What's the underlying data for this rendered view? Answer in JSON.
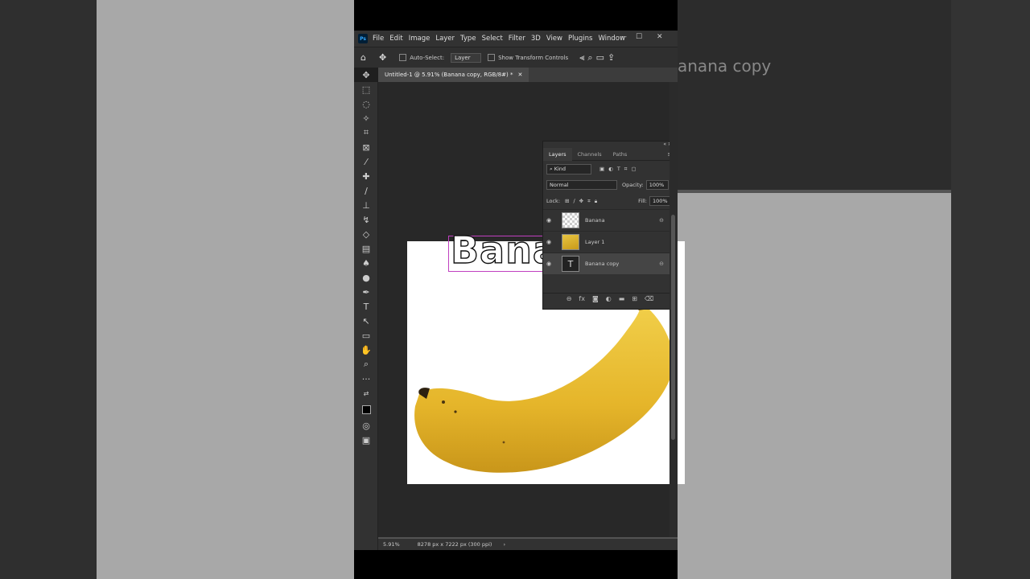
{
  "menubar": {
    "logo": "Ps",
    "items": [
      "File",
      "Edit",
      "Image",
      "Layer",
      "Type",
      "Select",
      "Filter",
      "3D",
      "View",
      "Plugins",
      "Window"
    ]
  },
  "options": {
    "auto_select_label": "Auto-Select:",
    "auto_select_target": "Layer",
    "show_transform_label": "Show Transform Controls"
  },
  "document": {
    "tab_title": "Untitled-1 @ 5.91% (Banana  copy, RGB/8#) *",
    "canvas_text": "Banana"
  },
  "status": {
    "zoom": "5.91%",
    "size": "8278 px x 7222 px (300 ppi)"
  },
  "layers_panel": {
    "tabs": [
      "Layers",
      "Channels",
      "Paths"
    ],
    "filter_kind": "Kind",
    "blend_mode": "Normal",
    "opacity_label": "Opacity:",
    "opacity_value": "100%",
    "lock_label": "Lock:",
    "fill_label": "Fill:",
    "fill_value": "100%",
    "layers": [
      {
        "name": "Banana"
      },
      {
        "name": "Layer 1"
      },
      {
        "name": "Banana  copy"
      }
    ]
  },
  "background": {
    "right_layer_label": "anana  copy"
  }
}
